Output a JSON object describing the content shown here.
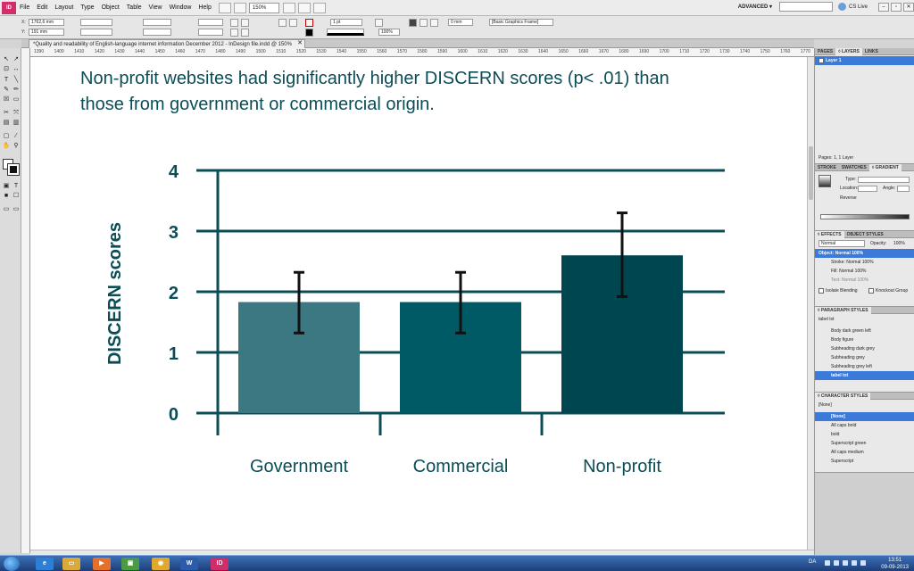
{
  "menubar": {
    "logo": "ID",
    "menus": [
      "File",
      "Edit",
      "Layout",
      "Type",
      "Object",
      "Table",
      "View",
      "Window",
      "Help"
    ],
    "zoom": "150%",
    "workspace": "ADVANCED ▾",
    "cs_live": "CS Live"
  },
  "control": {
    "x_label": "X:",
    "x_value": "1762,6 mm",
    "y_label": "Y:",
    "y_value": "191 mm",
    "stroke_weight": "1 pt",
    "stroke_offset": "0 mm",
    "opacity": "100%",
    "frame_style": "[Basic Graphics Frame]"
  },
  "document_tab": {
    "title": "*Quality and readability of English-language internet information December 2012 - InDesign file.indd @ 150%",
    "close": "✕"
  },
  "ruler": [
    "1390",
    "1400",
    "1410",
    "1420",
    "1430",
    "1440",
    "1450",
    "1460",
    "1470",
    "1480",
    "1490",
    "1500",
    "1510",
    "1520",
    "1530",
    "1540",
    "1550",
    "1560",
    "1570",
    "1580",
    "1590",
    "1600",
    "1610",
    "1620",
    "1630",
    "1640",
    "1650",
    "1660",
    "1670",
    "1680",
    "1690",
    "1700",
    "1710",
    "1720",
    "1730",
    "1740",
    "1750",
    "1760",
    "1770"
  ],
  "slide": {
    "title_line1": "Non-profit websites had significantly higher DISCERN scores (p< .01) than",
    "title_line2": "those from government or commercial origin."
  },
  "chart_data": {
    "type": "bar",
    "categories": [
      "Government",
      "Commercial",
      "Non-profit"
    ],
    "values": [
      1.83,
      1.83,
      2.6
    ],
    "error_low": [
      1.32,
      1.32,
      1.92
    ],
    "error_high": [
      2.32,
      2.32,
      3.3
    ],
    "ylabel": "DISCERN scores",
    "ylim": [
      0,
      4
    ],
    "yticks": [
      "0",
      "1",
      "2",
      "3",
      "4"
    ],
    "bar_colors": [
      "#3c7882",
      "#005a66",
      "#004650"
    ],
    "grid": true
  },
  "panels": {
    "pages_tab": "PAGES",
    "layers_tab": "◊ LAYERS",
    "links_tab": "LINKS",
    "layer1": "Layer 1",
    "pages_status": "Pages: 1, 1 Layer",
    "stroke_tab": "STROKE",
    "swatches_tab": "SWATCHES",
    "gradient_tab": "◊ GRADIENT",
    "type_label": "Type:",
    "location_label": "Location:",
    "angle_label": "Angle:",
    "reverse_label": "Reverse",
    "effects_tab": "◊ EFFECTS",
    "object_styles_tab": "OBJECT STYLES",
    "blend_mode": "Normal",
    "opacity_label": "Opacity:",
    "opacity_value": "100%",
    "effects_rows": [
      "Object: Normal 100%",
      "Stroke: Normal 100%",
      "Fill: Normal 100%",
      "Text: Normal 100%"
    ],
    "isolate": "Isolate Blending",
    "knockout": "Knockout Group",
    "para_tab": "◊ PARAGRAPH STYLES",
    "para_current": "tabel txt",
    "para_styles": [
      "Body dark green left",
      "Body figure",
      "Subheading dark grey",
      "Subheading grey",
      "Subheading grey left",
      "tabel txt"
    ],
    "char_tab": "◊ CHARACTER STYLES",
    "char_current": "[None]",
    "char_styles": [
      "[None]",
      "All caps bold",
      "bold",
      "Superscript green",
      "All caps medium",
      "Superscript"
    ]
  },
  "taskbar": {
    "indesign": "ID",
    "lang": "DA",
    "time": "13:51",
    "date": "09-09-2013"
  }
}
